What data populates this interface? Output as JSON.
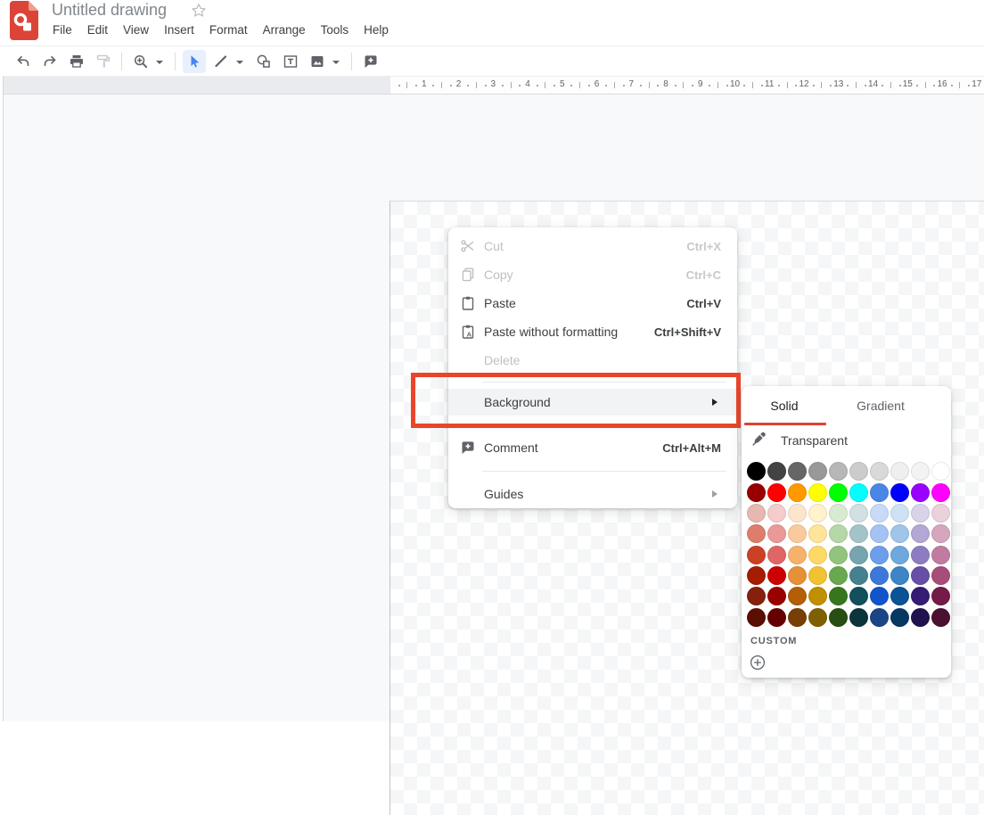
{
  "header": {
    "title": "Untitled drawing",
    "menus": [
      "File",
      "Edit",
      "View",
      "Insert",
      "Format",
      "Arrange",
      "Tools",
      "Help"
    ]
  },
  "toolbar": {
    "icons": [
      "undo-icon",
      "redo-icon",
      "print-icon",
      "paint-format-icon",
      "zoom-icon",
      "select-icon",
      "line-icon",
      "shape-icon",
      "text-box-icon",
      "image-icon",
      "insert-comment-icon"
    ],
    "selected_tool": "select"
  },
  "ruler": {
    "numbers": [
      1,
      2,
      3,
      4,
      5,
      6,
      7,
      8,
      9,
      10,
      11,
      12,
      13,
      14,
      15,
      16,
      17
    ]
  },
  "context_menu": {
    "items": [
      {
        "type": "item",
        "label": "Cut",
        "shortcut": "Ctrl+X",
        "icon": "scissors-icon",
        "enabled": false
      },
      {
        "type": "item",
        "label": "Copy",
        "shortcut": "Ctrl+C",
        "icon": "copy-icon",
        "enabled": false
      },
      {
        "type": "item",
        "label": "Paste",
        "shortcut": "Ctrl+V",
        "icon": "paste-icon",
        "enabled": true
      },
      {
        "type": "item",
        "label": "Paste without formatting",
        "shortcut": "Ctrl+Shift+V",
        "icon": "paste-without-formatting-icon",
        "enabled": true
      },
      {
        "type": "item",
        "label": "Delete",
        "shortcut": "",
        "enabled": false
      },
      {
        "type": "separator"
      },
      {
        "type": "item",
        "label": "Background",
        "submenu": true,
        "enabled": true,
        "highlighted": true
      },
      {
        "type": "separator"
      },
      {
        "type": "item",
        "label": "Comment",
        "shortcut": "Ctrl+Alt+M",
        "icon": "add-comment-icon",
        "enabled": true
      },
      {
        "type": "separator"
      },
      {
        "type": "item",
        "label": "Guides",
        "submenu": true,
        "enabled": true
      }
    ]
  },
  "annotation": {
    "shape": "rectangle",
    "color": "#e8452a",
    "target": "Background menu item"
  },
  "color_picker": {
    "tabs": [
      {
        "label": "Solid",
        "active": true
      },
      {
        "label": "Gradient",
        "active": false
      }
    ],
    "active_tab_accent": "#dd4232",
    "transparent_label": "Transparent",
    "custom_label": "CUSTOM",
    "palette_rows": [
      [
        "#000000",
        "#434343",
        "#666666",
        "#999999",
        "#b7b7b7",
        "#cccccc",
        "#d9d9d9",
        "#efefef",
        "#f3f3f3",
        "#ffffff"
      ],
      [
        "#980000",
        "#ff0000",
        "#ff9900",
        "#ffff00",
        "#00ff00",
        "#00ffff",
        "#4a86e8",
        "#0000ff",
        "#9900ff",
        "#ff00ff"
      ],
      [
        "#e6b8af",
        "#f4cccc",
        "#fce5cd",
        "#fff2cc",
        "#d9ead3",
        "#d0e0e3",
        "#c9daf8",
        "#cfe2f3",
        "#d9d2e9",
        "#ead1dc"
      ],
      [
        "#dd7e6b",
        "#ea9999",
        "#f9cb9c",
        "#ffe599",
        "#b6d7a8",
        "#a2c4c9",
        "#a4c2f4",
        "#9fc5e8",
        "#b4a7d6",
        "#d5a6bd"
      ],
      [
        "#cc4125",
        "#e06666",
        "#f6b26b",
        "#ffd966",
        "#93c47d",
        "#76a5af",
        "#6d9eeb",
        "#6fa8dc",
        "#8e7cc3",
        "#c27ba0"
      ],
      [
        "#a61c00",
        "#cc0000",
        "#e69138",
        "#f1c232",
        "#6aa84f",
        "#45818e",
        "#3c78d8",
        "#3d85c6",
        "#674ea7",
        "#a64d79"
      ],
      [
        "#85200c",
        "#990000",
        "#b45f06",
        "#bf9000",
        "#38761d",
        "#134f5c",
        "#1155cc",
        "#0b5394",
        "#351c75",
        "#741b47"
      ],
      [
        "#5b0f00",
        "#660000",
        "#783f04",
        "#7f6000",
        "#274e13",
        "#0c343d",
        "#1c4587",
        "#073763",
        "#20124d",
        "#4c1130"
      ]
    ]
  }
}
